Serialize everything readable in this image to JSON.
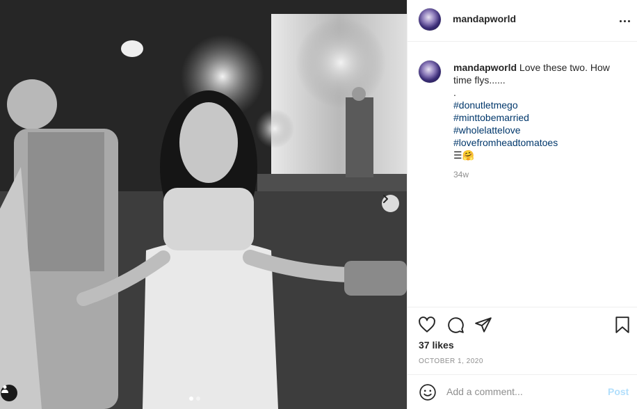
{
  "post": {
    "username": "mandapworld",
    "caption_text": "Love these two. How time flys......",
    "caption_dot": ".",
    "hashtags": [
      "#donutletmego",
      "#minttobemarried",
      "#wholelattelove",
      "#lovefromheadtomatoes"
    ],
    "emoji_line": "☰🤗",
    "time_ago": "34w",
    "likes": "37 likes",
    "date": "OCTOBER 1, 2020"
  },
  "comment": {
    "placeholder": "Add a comment...",
    "post_label": "Post"
  },
  "carousel": {
    "slide_count": 2,
    "active_index": 0
  },
  "colors": {
    "hashtag": "#00376b",
    "post_button_disabled": "#b2dffc",
    "muted": "#8e8e8e"
  },
  "icons": {
    "like": "heart-icon",
    "comment": "comment-icon",
    "share": "paper-plane-icon",
    "save": "bookmark-icon",
    "emoji": "smiley-icon",
    "more": "more-dots-icon",
    "next": "chevron-right-icon",
    "tag": "user-tag-icon"
  }
}
